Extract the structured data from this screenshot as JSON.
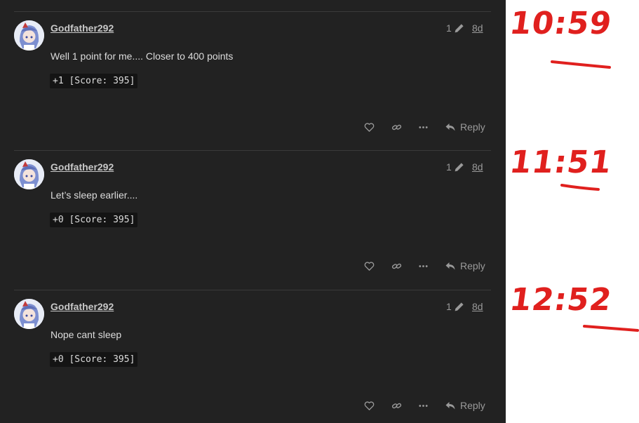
{
  "posts": [
    {
      "username": "Godfather292",
      "edit_count": "1",
      "age": "8d",
      "text": "Well 1 point for me.... Closer to 400 points",
      "code": "+1 [Score: 395]",
      "reply_label": "Reply"
    },
    {
      "username": "Godfather292",
      "edit_count": "1",
      "age": "8d",
      "text": "Let’s sleep earlier....",
      "code": "+0 [Score: 395]",
      "reply_label": "Reply"
    },
    {
      "username": "Godfather292",
      "edit_count": "1",
      "age": "8d",
      "text": "Nope cant sleep",
      "code": "+0 [Score: 395]",
      "reply_label": "Reply"
    }
  ],
  "annotations": [
    "10:59",
    "11:51",
    "12:52"
  ],
  "colors": {
    "background": "#222222",
    "text": "#dcdcdc",
    "muted": "#9a9a9a",
    "annotation": "#e0201e"
  },
  "icons": [
    "heart-icon",
    "link-icon",
    "more-icon",
    "reply-icon",
    "pencil-icon"
  ]
}
